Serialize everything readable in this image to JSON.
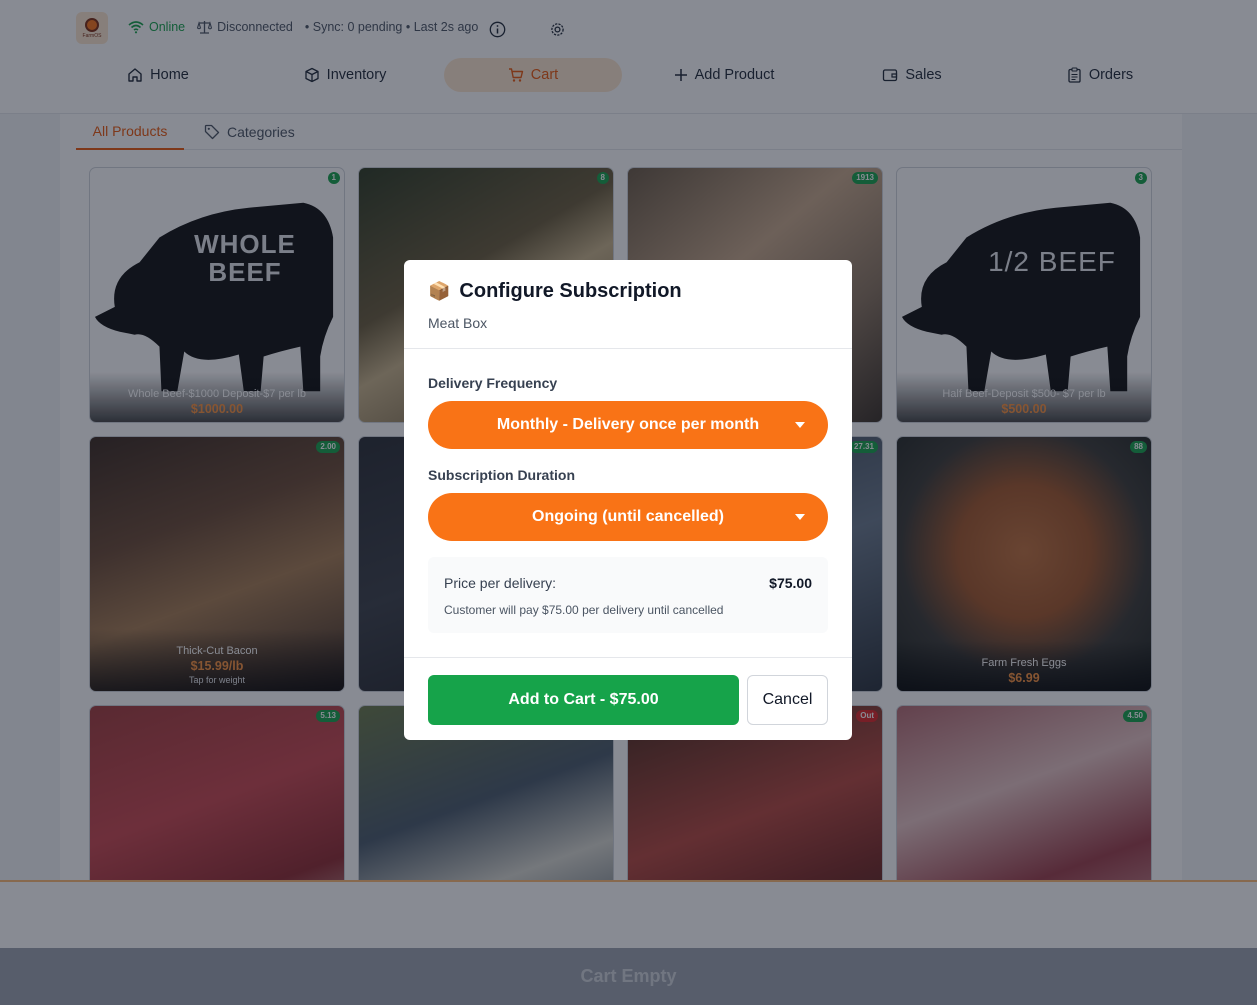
{
  "app": {
    "logo_text": "FarmOS"
  },
  "status": {
    "online": "Online",
    "scale": "Disconnected",
    "sync": "• Sync: 0 pending • Last 2s ago"
  },
  "nav": {
    "home": "Home",
    "inventory": "Inventory",
    "cart": "Cart",
    "add_product": "Add Product",
    "sales": "Sales",
    "orders": "Orders"
  },
  "tabs": {
    "all": "All Products",
    "categories": "Categories"
  },
  "products": [
    {
      "name": "Whole Beef-$1000 Deposit-$7 per lb",
      "price": "$1000.00",
      "badge": "1",
      "image_text": [
        "WHOLE",
        "BEEF"
      ]
    },
    {
      "name": "",
      "price": "",
      "badge": "8"
    },
    {
      "name": "",
      "price": "",
      "badge": "1913"
    },
    {
      "name": "Half Beef-Deposit $500- $7 per lb",
      "price": "$500.00",
      "badge": "3",
      "image_text": [
        "1/2 BEEF"
      ]
    },
    {
      "name": "Thick-Cut Bacon",
      "price": "$15.99/lb",
      "hint": "Tap for weight",
      "badge": "2.00"
    },
    {
      "name": "",
      "price": "",
      "badge": ""
    },
    {
      "name": "",
      "price": "",
      "badge": "27.31"
    },
    {
      "name": "Farm Fresh Eggs",
      "price": "$6.99",
      "badge": "88"
    },
    {
      "name": "",
      "price": "",
      "badge": "5.13"
    },
    {
      "name": "",
      "price": "",
      "badge": ""
    },
    {
      "name": "",
      "price": "",
      "badge": "Out"
    },
    {
      "name": "",
      "price": "",
      "badge": "4.50"
    }
  ],
  "bottom": {
    "cart_empty": "Cart Empty"
  },
  "modal": {
    "icon": "📦",
    "title": "Configure Subscription",
    "subtitle": "Meat Box",
    "frequency_label": "Delivery Frequency",
    "frequency_value": "Monthly - Delivery once per month",
    "duration_label": "Subscription Duration",
    "duration_value": "Ongoing (until cancelled)",
    "price_label": "Price per delivery:",
    "price_value": "$75.00",
    "price_note": "Customer will pay $75.00 per delivery until cancelled",
    "add_button": "Add to Cart - $75.00",
    "cancel_button": "Cancel"
  },
  "colors": {
    "accent": "#f97316",
    "success": "#16a34a",
    "online": "#16a34a",
    "cart_bg": "#fde7cf"
  }
}
